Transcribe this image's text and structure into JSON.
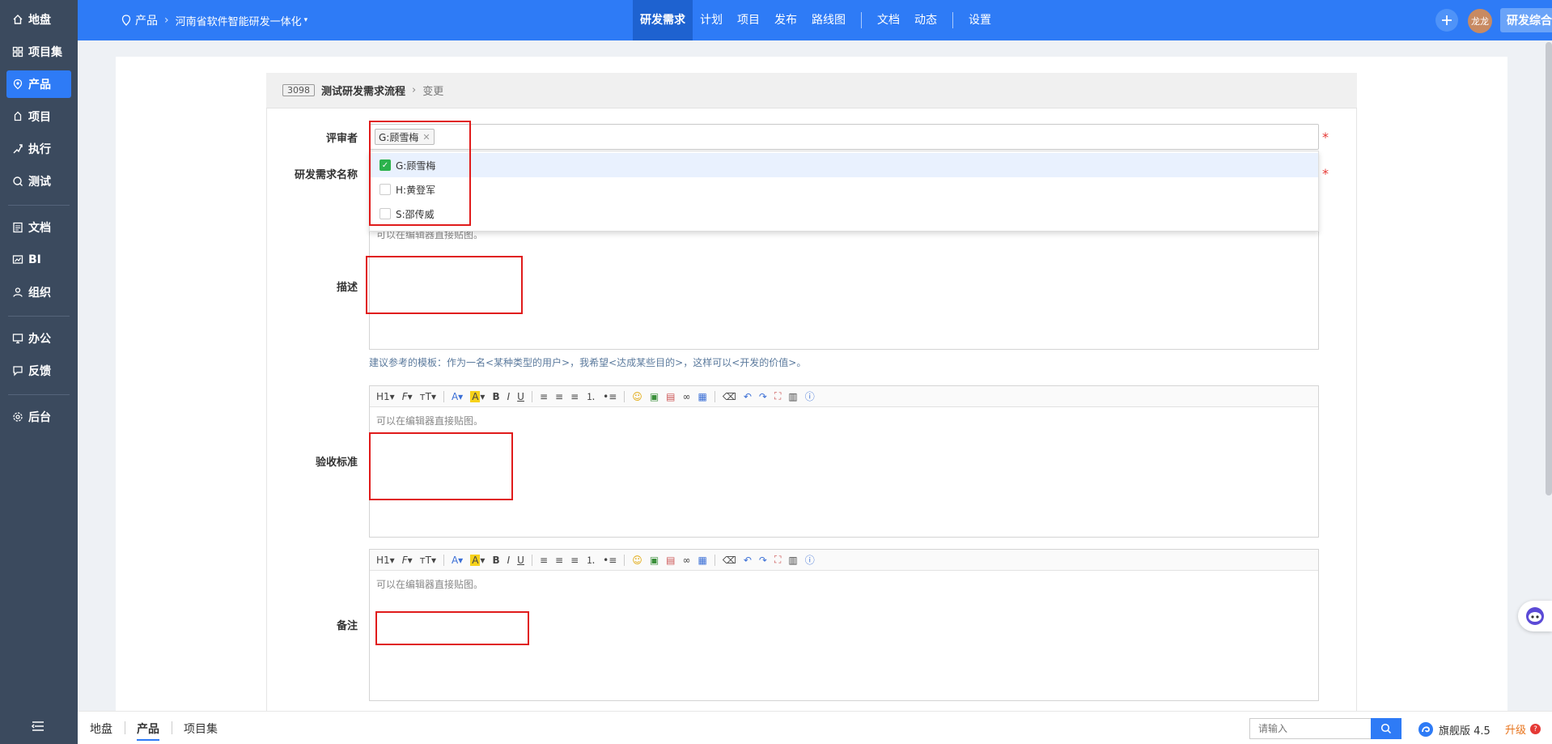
{
  "sidebar": {
    "items": [
      {
        "label": "地盘",
        "icon": "home-icon"
      },
      {
        "label": "项目集",
        "icon": "grid-icon"
      },
      {
        "label": "产品",
        "icon": "product-icon"
      },
      {
        "label": "项目",
        "icon": "project-icon"
      },
      {
        "label": "执行",
        "icon": "run-icon"
      },
      {
        "label": "测试",
        "icon": "test-icon"
      },
      {
        "label": "文档",
        "icon": "doc-icon"
      },
      {
        "label": "BI",
        "icon": "chart-icon"
      },
      {
        "label": "组织",
        "icon": "org-icon"
      },
      {
        "label": "办公",
        "icon": "office-icon"
      },
      {
        "label": "反馈",
        "icon": "feedback-icon"
      },
      {
        "label": "后台",
        "icon": "gear-icon"
      }
    ],
    "active_index": 2
  },
  "topbar": {
    "breadcrumb": {
      "root": "产品",
      "product": "河南省软件智能研发一体化"
    },
    "nav": [
      "研发需求",
      "计划",
      "项目",
      "发布",
      "路线图",
      "文档",
      "动态",
      "设置"
    ],
    "active_nav": "研发需求",
    "avatar_text": "龙龙",
    "switch_label": "研发综合界面",
    "accent_color": "#2e7bf6"
  },
  "form": {
    "header": {
      "id": "3098",
      "title": "测试研发需求流程",
      "action": "变更"
    },
    "reviewer_label": "评审者",
    "selected_reviewer": "G:顾雪梅",
    "reviewer_options": [
      {
        "label": "G:顾雪梅",
        "checked": true
      },
      {
        "label": "H:黄登军",
        "checked": false
      },
      {
        "label": "S:邵传威",
        "checked": false
      }
    ],
    "name_label": "研发需求名称",
    "desc_label": "描述",
    "accept_label": "验收标准",
    "notes_label": "备注",
    "editor_placeholder": "可以在编辑器直接贴图。",
    "desc_hint": "建议参考的模板：作为一名<某种类型的用户>，我希望<达成某些目的>，这样可以<开发的价值>。",
    "required_mark": "*"
  },
  "bottombar": {
    "tabs": [
      "地盘",
      "产品",
      "项目集"
    ],
    "active_tab": "产品",
    "search_placeholder": "请输入",
    "edition": "旗舰版 4.5",
    "upgrade": "升级"
  }
}
